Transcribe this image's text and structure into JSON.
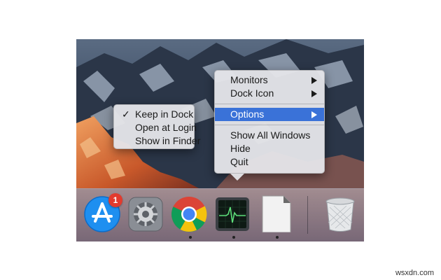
{
  "dock": {
    "items": [
      {
        "icon": "app-store-icon",
        "badge": "1",
        "running": false
      },
      {
        "icon": "system-preferences-icon",
        "running": true
      },
      {
        "icon": "chrome-icon",
        "running": true
      },
      {
        "icon": "activity-monitor-icon",
        "running": true
      },
      {
        "icon": "libreoffice-icon",
        "running": true
      },
      {
        "icon": "trash-icon",
        "running": false
      }
    ]
  },
  "context_menu": {
    "items": [
      {
        "label": "Monitors",
        "submenu": true
      },
      {
        "label": "Dock Icon",
        "submenu": true
      },
      {
        "label": "Options",
        "submenu": true,
        "highlighted": true
      },
      {
        "label": "Show All Windows"
      },
      {
        "label": "Hide"
      },
      {
        "label": "Quit"
      }
    ]
  },
  "options_submenu": {
    "items": [
      {
        "label": "Keep in Dock",
        "checked": true,
        "check_mark": "✓"
      },
      {
        "label": "Open at Login"
      },
      {
        "label": "Show in Finder"
      }
    ]
  },
  "colors": {
    "highlight": "#3a72d8",
    "badge": "#e23b2e"
  },
  "watermark": "wsxdn.com"
}
